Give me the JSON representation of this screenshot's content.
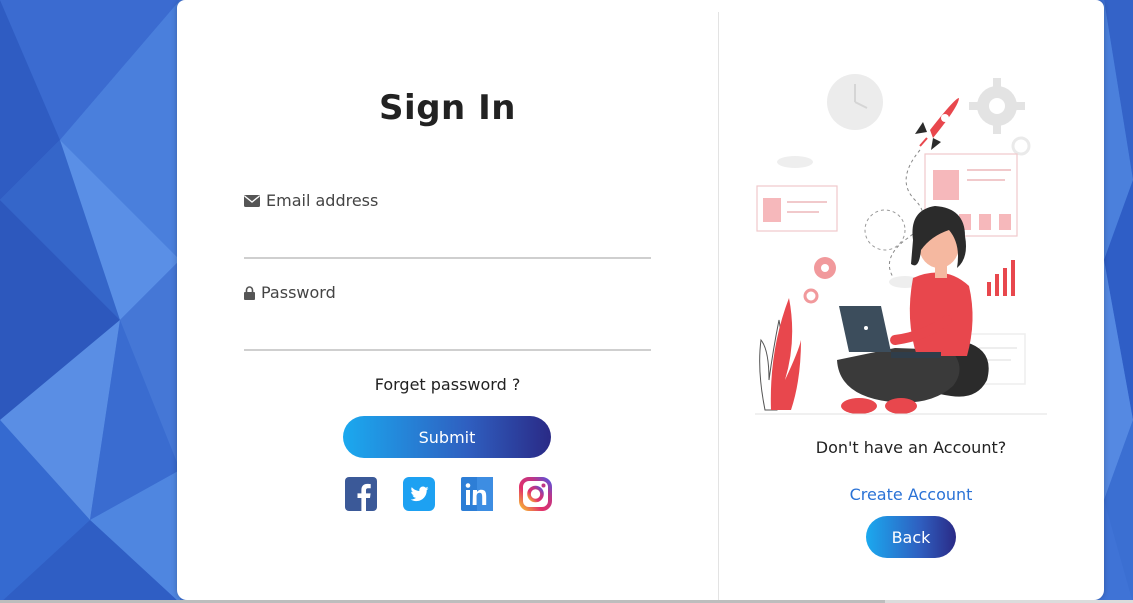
{
  "signin": {
    "title": "Sign In",
    "email_label": "Email address",
    "email_value": "",
    "password_label": "Password",
    "password_value": "",
    "forget_password": "Forget password ?",
    "submit_label": "Submit",
    "socials": [
      "facebook-icon",
      "twitter-icon",
      "linkedin-icon",
      "instagram-icon"
    ]
  },
  "signup_panel": {
    "prompt": "Don't have an Account?",
    "create_account": "Create Account",
    "back_label": "Back"
  },
  "colors": {
    "background": "#3f73d6",
    "accent_blue": "#1ba9ef",
    "accent_navy": "#2a2a86",
    "link": "#2a72d6",
    "illustration_red": "#e8474d"
  }
}
